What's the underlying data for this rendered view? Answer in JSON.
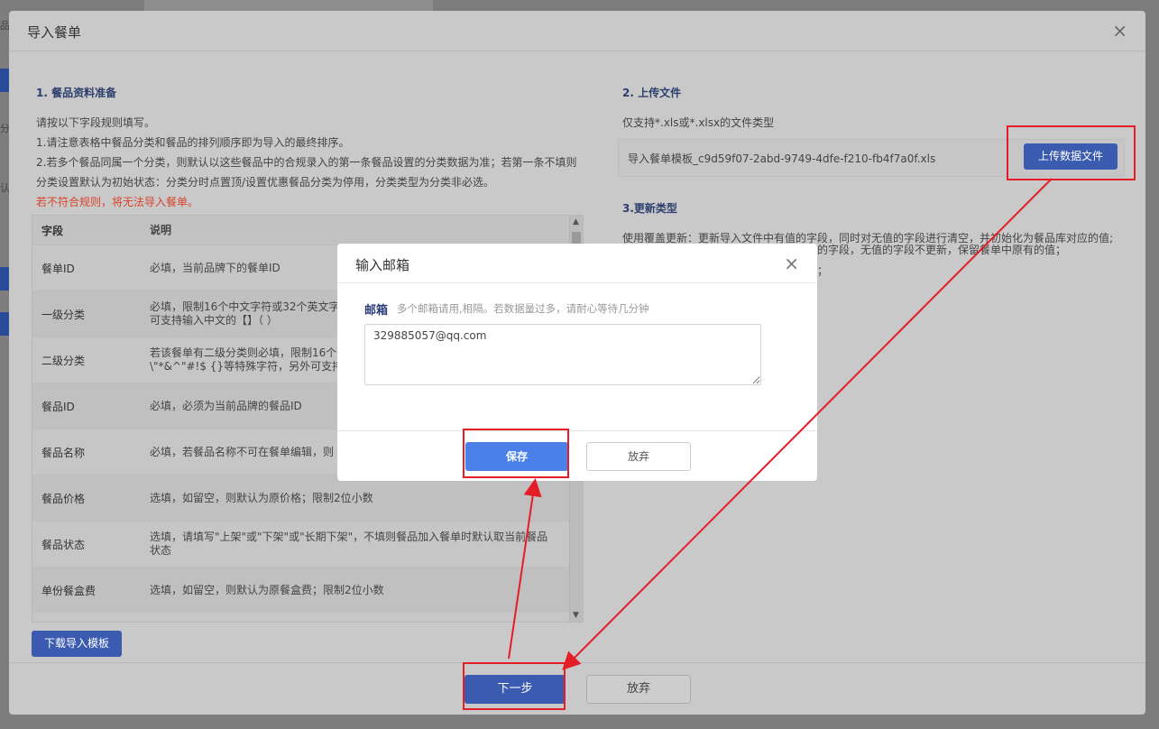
{
  "modal": {
    "title": "导入餐单",
    "close": "×",
    "section1": {
      "title": "1. 餐品资料准备",
      "lines": [
        "请按以下字段规则填写。",
        "1.请注意表格中餐品分类和餐品的排列顺序即为导入的最终排序。",
        "2.若多个餐品同属一个分类，则默认以这些餐品中的合规录入的第一条餐品设置的分类数据为准；若第一条不填则",
        "分类设置默认为初始状态：分类分时点置顶/设置优惠餐品分类为停用，分类类型为分类非必选。"
      ],
      "warning": "若不符合规则，将无法导入餐单。"
    },
    "table": {
      "headers": [
        "字段",
        "说明"
      ],
      "rows": [
        {
          "field": "餐单ID",
          "desc": "必填，当前品牌下的餐单ID"
        },
        {
          "field": "一级分类",
          "desc": "必填，限制16个中文字符或32个英文字\n可支持输入中文的【】（ ）"
        },
        {
          "field": "二级分类",
          "desc": "若该餐单有二级分类则必填，限制16个\n\\\"*&^\"#!$ {}等特殊字符，另外可支持输"
        },
        {
          "field": "餐品ID",
          "desc": "必填，必须为当前品牌的餐品ID"
        },
        {
          "field": "餐品名称",
          "desc": "必填，若餐品名称不可在餐单编辑，则"
        },
        {
          "field": "餐品价格",
          "desc": "选填，如留空，则默认为原价格；限制2位小数"
        },
        {
          "field": "餐品状态",
          "desc": "选填，请填写\"上架\"或\"下架\"或\"长期下架\"，不填则餐品加入餐单时默认取当前餐品\n状态"
        },
        {
          "field": "单份餐盒费",
          "desc": "选填，如留空，则默认为原餐盒费；限制2位小数"
        }
      ]
    },
    "download_button": "下载导入模板",
    "section2": {
      "title": "2. 上传文件",
      "hint": "仅支持*.xls或*.xlsx的文件类型",
      "file_name": "导入餐单模板_c9d59f07-2abd-9749-4dfe-f210-fb4f7a0f.xls",
      "upload_button": "上传数据文件"
    },
    "section3": {
      "title": "3.更新类型",
      "line1": "使用覆盖更新：更新导入文件中有值的字段，同时对无值的字段进行清空，并初始化为餐品库对应的值;",
      "line2_tail": "的字段，无值的字段不更新，保留餐单中原有的值；",
      "line3_tail": "；"
    },
    "next_button": "下一步",
    "cancel_button": "放弃"
  },
  "dialog": {
    "title": "输入邮箱",
    "close": "×",
    "label": "邮箱",
    "hint": "多个邮箱请用,相隔。若数据量过多，请耐心等待几分钟",
    "email_value": "329885057@qq.com",
    "save_button": "保存",
    "cancel_button": "放弃"
  },
  "background": {
    "left_fragments": [
      "品",
      "分",
      "认"
    ]
  },
  "colors": {
    "annotation_red": "#e51d26",
    "primary_blue": "#4a80e8",
    "dimmed_blue": "#3a5bb0"
  }
}
